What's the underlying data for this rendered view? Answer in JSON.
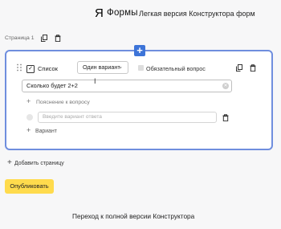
{
  "header": {
    "logo_ya": "Я",
    "logo_forms": "Формы",
    "title": "Легкая версия Конструктора форм"
  },
  "page": {
    "label": "Страница 1"
  },
  "question": {
    "type_label": "Список",
    "answer_mode": "Один вариант",
    "required_label": "Обязательный вопрос",
    "required_checked": false,
    "text_value": "Сколько будет 2+2",
    "add_hint_label": "Пояснение к вопросу",
    "option_placeholder": "Введите вариант ответа",
    "add_variant_label": "Вариант"
  },
  "actions": {
    "add_page_label": "Добавить страницу",
    "publish_label": "Опубликовать",
    "full_version_link": "Переход к полной версии Конструктора"
  },
  "colors": {
    "accent": "#3d74d8",
    "card_border": "#6f8ede",
    "publish_button": "#ffdb4d"
  },
  "icons": [
    "copy-icon",
    "trash-icon",
    "plus-icon",
    "drag-handle-icon",
    "checkbox-icon",
    "chevron-down-icon",
    "clear-icon",
    "radio-icon"
  ]
}
